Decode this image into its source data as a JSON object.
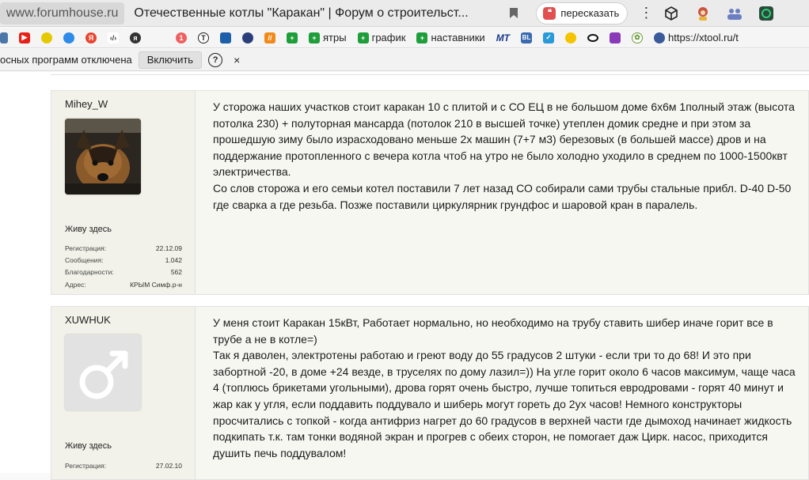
{
  "browser": {
    "url_host": "www.forumhouse.ru",
    "tab_title": "Отечественные котлы \"Каракан\" | Форум о строительст...",
    "retell_label": "пересказать",
    "kebab": "⋮"
  },
  "bookmarks": {
    "items": [
      {
        "label": "ятры",
        "color": "#1e9e3a"
      },
      {
        "label": "график",
        "color": "#1e9e3a"
      },
      {
        "label": "наставники",
        "color": "#1e9e3a"
      }
    ],
    "mt_label": "MT",
    "bl_label": "BL",
    "xtool_label": "https://xtool.ru/t"
  },
  "infobar": {
    "text": "осных программ отключена",
    "enable_label": "Включить",
    "help_label": "?",
    "close_label": "×"
  },
  "posts": [
    {
      "username": "Mihey_W",
      "status": "Живу здесь",
      "stats": [
        {
          "label": "Регистрация:",
          "value": "22.12.09"
        },
        {
          "label": "Сообщения:",
          "value": "1.042"
        },
        {
          "label": "Благодарности:",
          "value": "562"
        },
        {
          "label": "Адрес:",
          "value": "КРЫМ Симф.р-н"
        }
      ],
      "paragraphs": [
        "У сторожа наших участков стоит каракан 10 с плитой и с СО ЕЦ в не большом доме 6х6м 1полный этаж (высота потолка 230) + полуторная мансарда (потолок 210 в высшей точке) утеплен домик средне и при этом за прошедшую зиму было израсходовано меньше 2х машин (7+7 м3) березовых (в большей массе) дров и на поддержание протопленного с вечера котла чтоб на утро не было холодно уходило в среднем по 1000-1500квт электричества.",
        "Со слов сторожа и его семьи котел поставили 7 лет назад СО собирали сами трубы стальные прибл. D-40 D-50 где сварка а где резьба. Позже поставили циркулярник грундфос и шаровой кран в паралель."
      ]
    },
    {
      "username": "XUWHUK",
      "status": "Живу здесь",
      "stats": [
        {
          "label": "Регистрация:",
          "value": "27.02.10"
        }
      ],
      "paragraphs": [
        "У меня стоит Каракан 15кВт, Работает нормально, но необходимо на трубу ставить шибер иначе горит все в трубе а не в котле=)",
        "Так я даволен, электротены работаю и греют воду до 55 градусов 2 штуки - если три то до 68! И это при забортной -20, в доме +24 везде, в труселях по дому лазил=)) На угле горит около 6 часов максимум, чаще часа 4 (топлюсь брикетами угольными), дрова горят очень быстро, лучше топиться евродровами - горят 40 минут и жар как у угля, если поддавить поддувало и шиберь могут гореть до 2ух часов! Немного конструкторы просчитались с топкой - когда антифриз нагрет до 60 градусов в верхней части где дымоход начинает жидкость подкипать т.к. там тонки водяной экран и прогрев с обеих сторон, не помогает даж Цирк. насос, приходится душить печь поддувалом!"
      ]
    }
  ]
}
